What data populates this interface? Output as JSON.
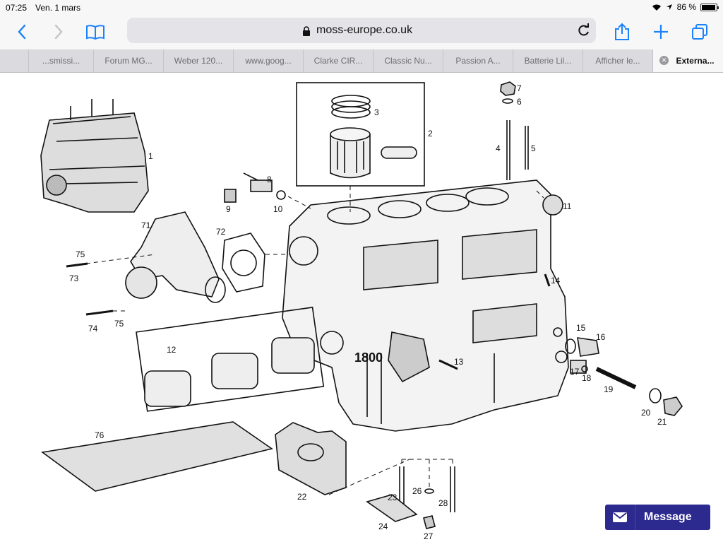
{
  "status_bar": {
    "time": "07:25",
    "date": "Ven. 1 mars",
    "battery_text": "86 %",
    "battery_level": 0.86
  },
  "browser": {
    "url": "moss-europe.co.uk",
    "tabs": [
      {
        "label": "...smissi..."
      },
      {
        "label": "Forum MG..."
      },
      {
        "label": "Weber 120..."
      },
      {
        "label": "www.goog..."
      },
      {
        "label": "Clarke CIR..."
      },
      {
        "label": "Classic Nu..."
      },
      {
        "label": "Passion A..."
      },
      {
        "label": "Batterie Lil..."
      },
      {
        "label": "Afficher le..."
      },
      {
        "label": "Externa...",
        "active": true
      }
    ]
  },
  "diagram": {
    "block_marking": "1800",
    "part_numbers": [
      "1",
      "2",
      "3",
      "4",
      "5",
      "6",
      "7",
      "8",
      "9",
      "10",
      "11",
      "12",
      "13",
      "14",
      "15",
      "16",
      "17",
      "18",
      "19",
      "20",
      "21",
      "22",
      "23",
      "24",
      "26",
      "27",
      "28",
      "71",
      "72",
      "73",
      "74",
      "75",
      "75",
      "76"
    ]
  },
  "message_button": {
    "label": "Message"
  },
  "colors": {
    "accent": "#1a82fb",
    "message_bg": "#2d2a8f"
  }
}
